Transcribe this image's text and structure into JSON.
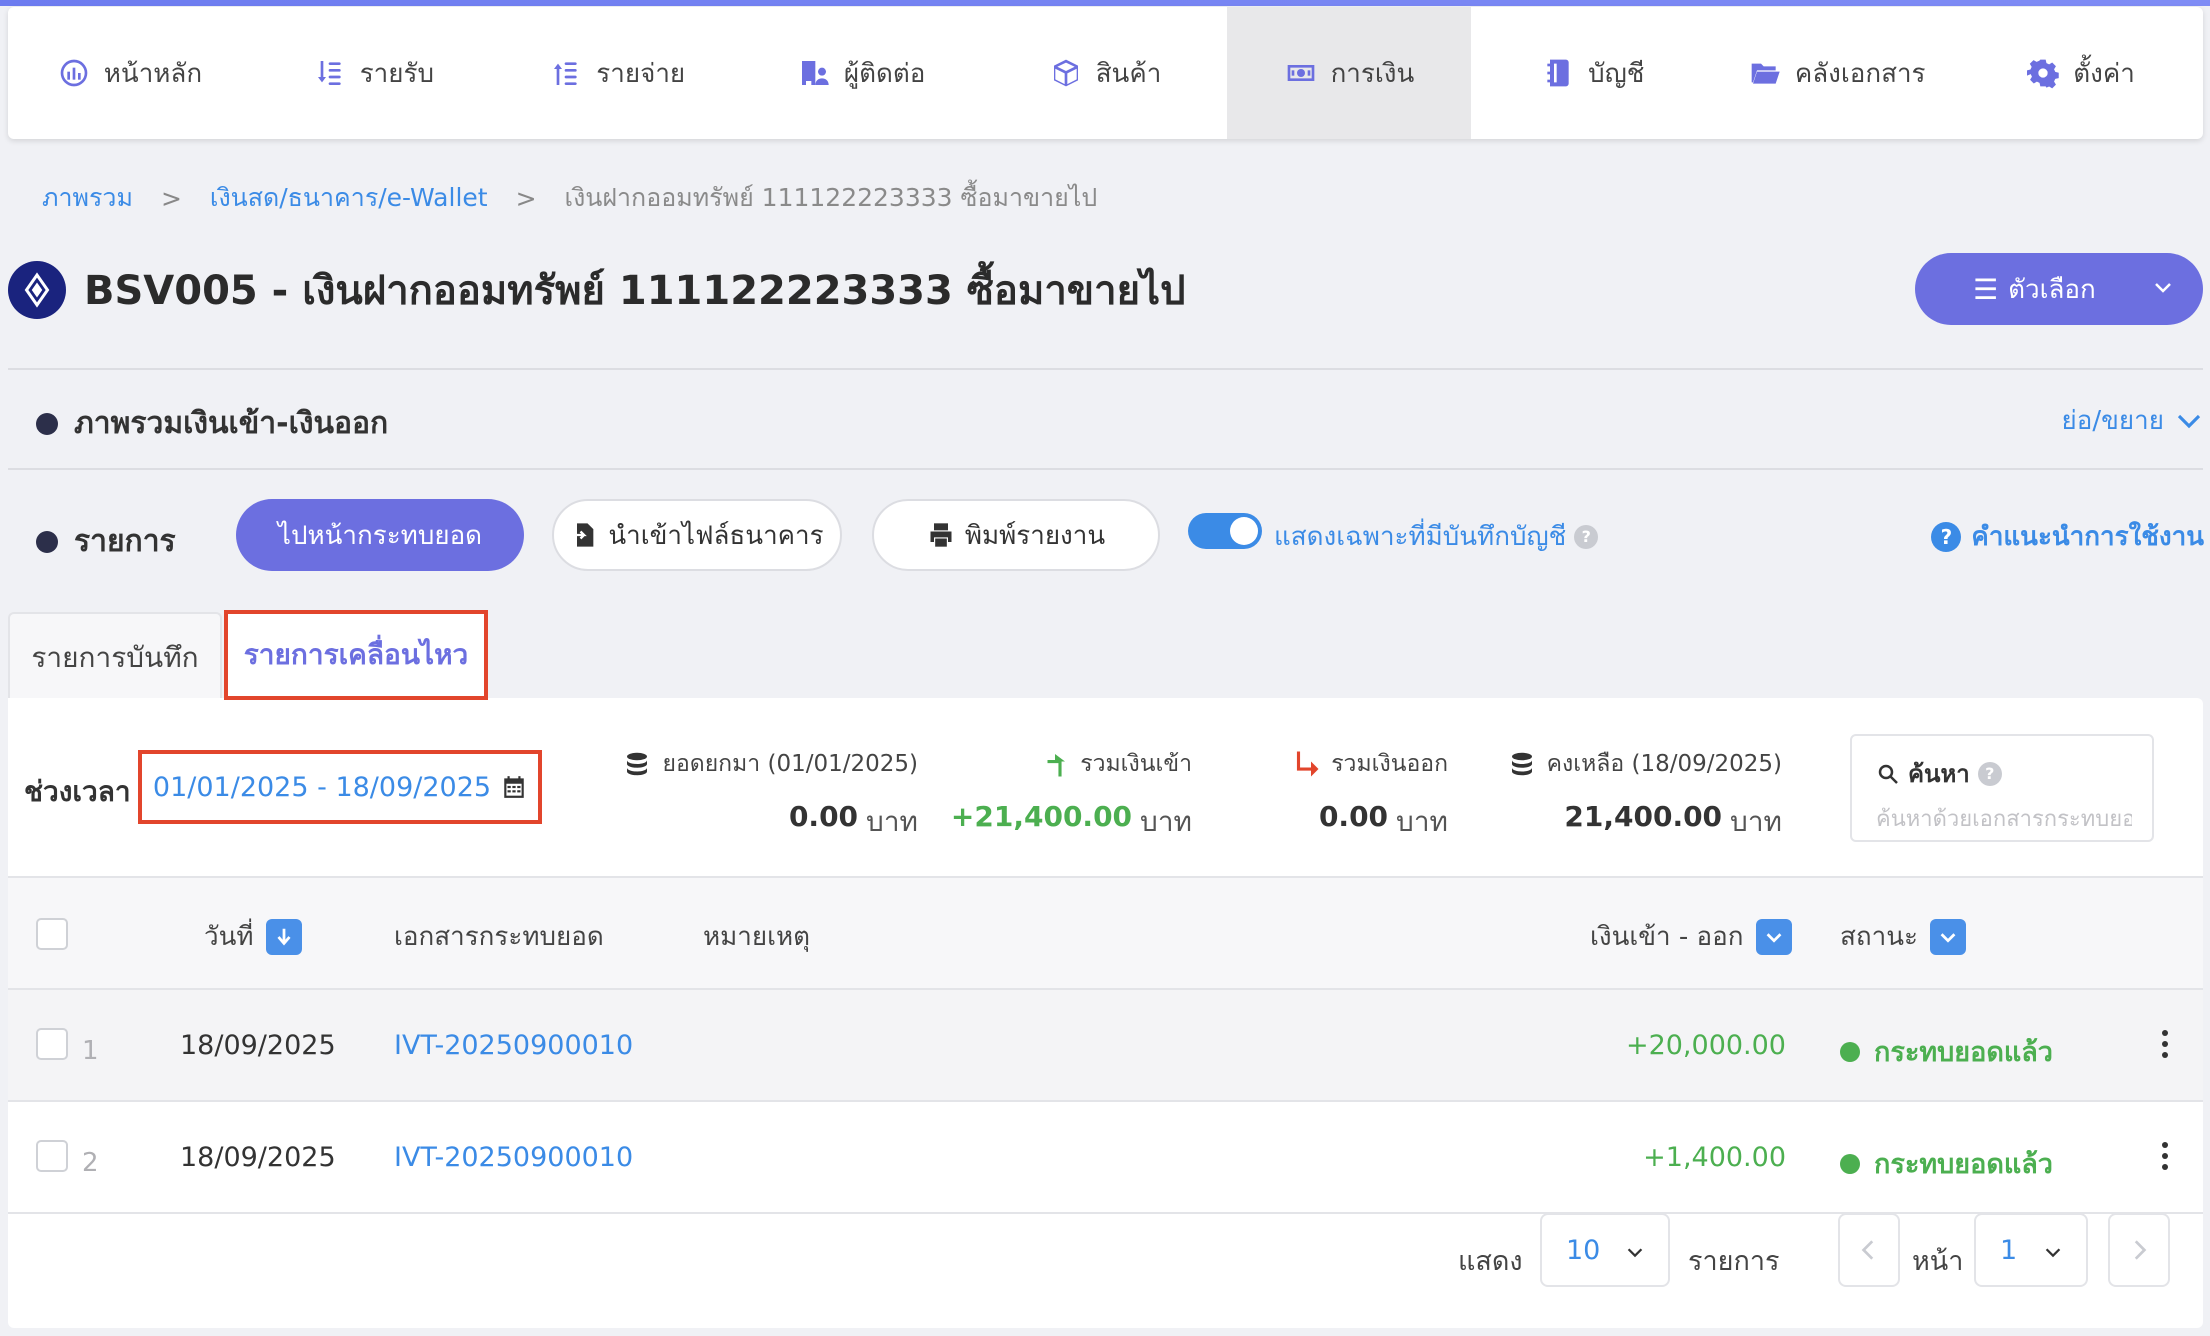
{
  "nav": {
    "items": [
      {
        "label": "หน้าหลัก",
        "icon": "dashboard-icon"
      },
      {
        "label": "รายรับ",
        "icon": "income-icon"
      },
      {
        "label": "รายจ่าย",
        "icon": "expense-icon"
      },
      {
        "label": "ผู้ติดต่อ",
        "icon": "contacts-icon"
      },
      {
        "label": "สินค้า",
        "icon": "product-box-icon"
      },
      {
        "label": "การเงิน",
        "icon": "money-icon"
      },
      {
        "label": "บัญชี",
        "icon": "ledger-book-icon"
      },
      {
        "label": "คลังเอกสาร",
        "icon": "folder-icon"
      },
      {
        "label": "ตั้งค่า",
        "icon": "gear-icon"
      }
    ],
    "active_index": 5
  },
  "breadcrumb": {
    "items": [
      "ภาพรวม",
      "เงินสด/ธนาคาร/e-Wallet",
      "เงินฝากออมทรัพย์ 111122223333 ซื้อมาขายไป"
    ],
    "separator": ">"
  },
  "page": {
    "title": "BSV005 - เงินฝากออมทรัพย์ 111122223333 ซื้อมาขายไป",
    "options_label": "ตัวเลือก",
    "options_icon": "menu-icon"
  },
  "overview": {
    "title": "ภาพรวมเงินเข้า-เงินออก",
    "collapse_label": "ย่อ/ขยาย"
  },
  "transactions": {
    "title": "รายการ",
    "reconcile_button": "ไปหน้ากระทบยอด",
    "import_button": "นำเข้าไฟล์ธนาคาร",
    "print_button": "พิมพ์รายงาน",
    "toggle_label": "แสดงเฉพาะที่มีบันทึกบัญชี",
    "toggle_on": true,
    "help_label": "คำแนะนำการใช้งาน"
  },
  "tabs": [
    {
      "label": "รายการบันทึก",
      "active": false
    },
    {
      "label": "รายการเคลื่อนไหว",
      "active": true
    }
  ],
  "filter": {
    "period_label": "ช่วงเวลา",
    "date_range": "01/01/2025 - 18/09/2025"
  },
  "stats": {
    "opening": {
      "label": "ยอดยกมา (01/01/2025)",
      "value": "0.00",
      "unit": "บาท"
    },
    "inflow": {
      "label": "รวมเงินเข้า",
      "value": "+21,400.00",
      "unit": "บาท"
    },
    "outflow": {
      "label": "รวมเงินออก",
      "value": "0.00",
      "unit": "บาท"
    },
    "balance": {
      "label": "คงเหลือ (18/09/2025)",
      "value": "21,400.00",
      "unit": "บาท"
    }
  },
  "search": {
    "label": "ค้นหา",
    "placeholder": "ค้นหาด้วยเอกสารกระทบยอด"
  },
  "table": {
    "columns": [
      "วันที่",
      "เอกสารกระทบยอด",
      "หมายเหตุ",
      "เงินเข้า - ออก",
      "สถานะ"
    ],
    "rows": [
      {
        "no": "1",
        "date": "18/09/2025",
        "doc": "IVT-20250900010",
        "note": "",
        "amount": "+20,000.00",
        "status": "กระทบยอดแล้ว"
      },
      {
        "no": "2",
        "date": "18/09/2025",
        "doc": "IVT-20250900010",
        "note": "",
        "amount": "+1,400.00",
        "status": "กระทบยอดแล้ว"
      }
    ]
  },
  "pagination": {
    "show_label": "แสดง",
    "page_size": "10",
    "items_label": "รายการ",
    "page_label": "หน้า",
    "current_page": "1"
  },
  "colors": {
    "accent": "#6c6fe0",
    "link": "#3b8be6",
    "positive": "#4caf50",
    "highlight_box": "#e2452c"
  }
}
